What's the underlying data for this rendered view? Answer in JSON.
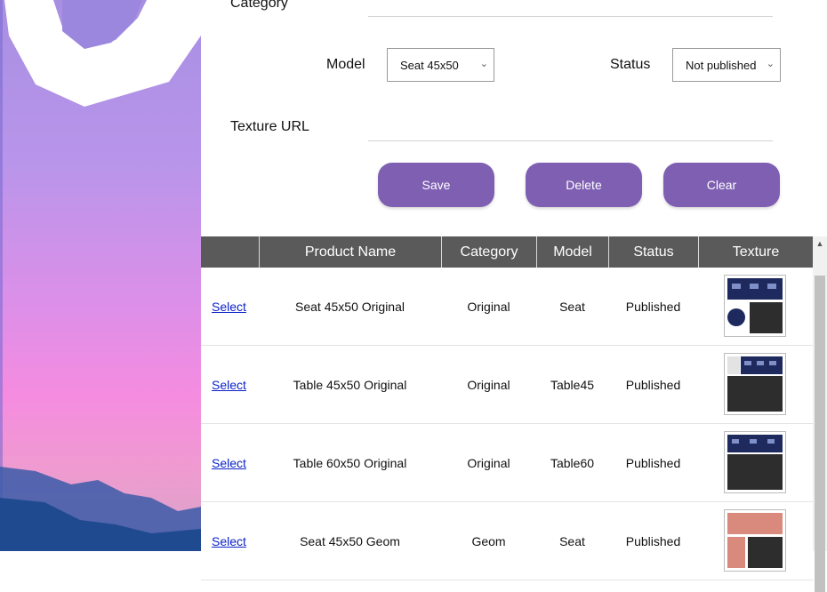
{
  "form": {
    "category_label": "Category",
    "model_label": "Model",
    "model_value": "Seat 45x50",
    "status_label": "Status",
    "status_value": "Not published",
    "texture_label": "Texture URL"
  },
  "buttons": {
    "save": "Save",
    "delete": "Delete",
    "clear": "Clear"
  },
  "table": {
    "headers": [
      "",
      "Product Name",
      "Category",
      "Model",
      "Status",
      "Texture"
    ],
    "rows": [
      {
        "action": "Select",
        "name": "Seat 45x50 Original",
        "category": "Original",
        "model": "Seat",
        "status": "Published"
      },
      {
        "action": "Select",
        "name": "Table 45x50 Original",
        "category": "Original",
        "model": "Table45",
        "status": "Published"
      },
      {
        "action": "Select",
        "name": "Table 60x50 Original",
        "category": "Original",
        "model": "Table60",
        "status": "Published"
      },
      {
        "action": "Select",
        "name": "Seat 45x50 Geom",
        "category": "Geom",
        "model": "Seat",
        "status": "Published"
      }
    ]
  },
  "colors": {
    "button": "#7e5fb2",
    "header": "#5a5a5a",
    "link": "#0b22c8"
  }
}
